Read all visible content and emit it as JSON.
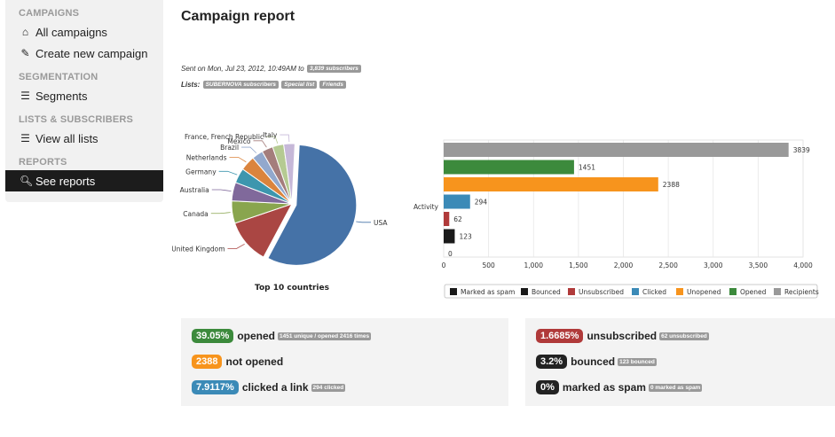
{
  "sidebar": {
    "sections": [
      {
        "heading": "CAMPAIGNS",
        "items": [
          {
            "label": "All campaigns",
            "icon": "home-icon"
          },
          {
            "label": "Create new campaign",
            "icon": "edit-icon"
          }
        ]
      },
      {
        "heading": "SEGMENTATION",
        "items": [
          {
            "label": "Segments",
            "icon": "list-icon"
          }
        ]
      },
      {
        "heading": "LISTS & SUBSCRIBERS",
        "items": [
          {
            "label": "View all lists",
            "icon": "list-icon"
          }
        ]
      },
      {
        "heading": "REPORTS",
        "items": [
          {
            "label": "See reports",
            "icon": "search-icon",
            "active": true
          }
        ]
      }
    ]
  },
  "report": {
    "title": "Campaign report",
    "sent_text": "Sent on Mon, Jul 23, 2012, 10:49AM to",
    "subscribers_tag": "3,839 subscribers",
    "lists_label": "Lists:",
    "lists": [
      "SUBERNOVA subscribers",
      "Special list",
      "Friends"
    ]
  },
  "chart_data": [
    {
      "type": "pie",
      "title": "Top 10 countries",
      "categories": [
        "USA",
        "United Kingdom",
        "Canada",
        "Australia",
        "Germany",
        "Netherlands",
        "Brazil",
        "Mexico",
        "France, French Republic",
        "Italy"
      ],
      "values": [
        57,
        12,
        6,
        5,
        4,
        4,
        3,
        3,
        3,
        3
      ],
      "colors": [
        "#4572a7",
        "#aa4643",
        "#89a54e",
        "#80699b",
        "#3d96ae",
        "#db843d",
        "#92a8cd",
        "#a47d7c",
        "#b5ca92",
        "#c6b8d8"
      ]
    },
    {
      "type": "bar",
      "orientation": "horizontal",
      "category_label": "Activity",
      "series": [
        {
          "name": "Recipients",
          "values": [
            3839
          ],
          "color": "#999999"
        },
        {
          "name": "Opened",
          "values": [
            1451
          ],
          "color": "#3c8a3c"
        },
        {
          "name": "Unopened",
          "values": [
            2388
          ],
          "color": "#f7941d"
        },
        {
          "name": "Clicked",
          "values": [
            294
          ],
          "color": "#3b8ab7"
        },
        {
          "name": "Unsubscribed",
          "values": [
            62
          ],
          "color": "#b03a3a"
        },
        {
          "name": "Bounced",
          "values": [
            123
          ],
          "color": "#1a1a1a"
        },
        {
          "name": "Marked as spam",
          "values": [
            0
          ],
          "color": "#1a1a1a"
        }
      ],
      "xlim": [
        0,
        4000
      ],
      "xticks": [
        "0",
        "500",
        "1,000",
        "1,500",
        "2,000",
        "2,500",
        "3,000",
        "3,500",
        "4,000"
      ],
      "legend_order": [
        "Marked as spam",
        "Bounced",
        "Unsubscribed",
        "Clicked",
        "Unopened",
        "Opened",
        "Recipients"
      ],
      "legend": "bottom"
    }
  ],
  "stats_left": [
    {
      "pill": "39.05%",
      "text": "opened",
      "note": "1451 unique / opened 2416 times",
      "color": "#3c8a3c"
    },
    {
      "pill": "2388",
      "text": "not opened",
      "note": "",
      "color": "#f7941d"
    },
    {
      "pill": "7.9117%",
      "text": "clicked a link",
      "note": "294 clicked",
      "color": "#3b8ab7"
    }
  ],
  "stats_right": [
    {
      "pill": "1.6685%",
      "text": "unsubscribed",
      "note": "62 unsubscribed",
      "color": "#b03a3a"
    },
    {
      "pill": "3.2%",
      "text": "bounced",
      "note": "123 bounced",
      "color": "#222222"
    },
    {
      "pill": "0%",
      "text": "marked as spam",
      "note": "0 marked as spam",
      "color": "#222222"
    }
  ]
}
